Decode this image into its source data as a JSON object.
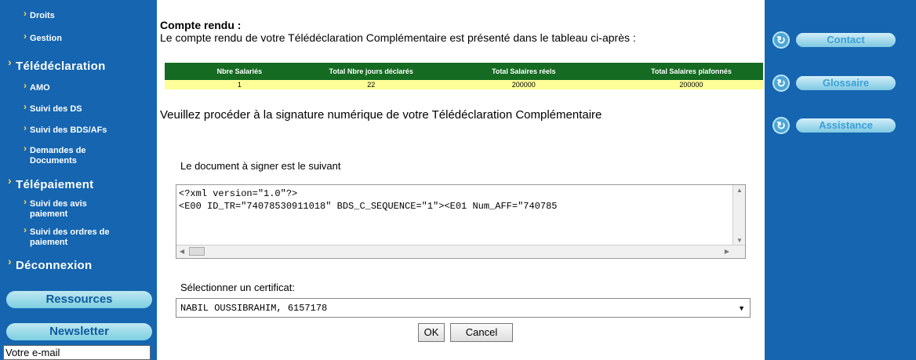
{
  "sidebar": {
    "items": [
      {
        "label": "Droits"
      },
      {
        "label": "Gestion"
      },
      {
        "label": "Télédéclaration"
      },
      {
        "label": "AMO"
      },
      {
        "label": "Suivi des DS"
      },
      {
        "label": "Suivi des BDS/AFs"
      },
      {
        "label": "Demandes de Documents"
      },
      {
        "label": "Télépaiement"
      },
      {
        "label": "Suivi des avis paiement"
      },
      {
        "label": "Suivi des ordres de paiement"
      },
      {
        "label": "Déconnexion"
      }
    ],
    "ressources": "Ressources",
    "newsletter": "Newsletter",
    "email_placeholder": "Votre e-mail"
  },
  "main": {
    "title": "Compte rendu :",
    "description": "Le compte rendu de votre Télédéclaration Complémentaire est présenté dans le tableau ci-après :",
    "table": {
      "headers": [
        "Nbre Salariés",
        "Total Nbre jours déclarés",
        "Total Salaires réels",
        "Total Salaires plafonnés"
      ],
      "row": [
        "1",
        "22",
        "200000",
        "200000"
      ]
    },
    "sign_prompt": "Veuillez procéder à la signature numérique de votre Télédéclaration Complémentaire",
    "doc_label": "Le document à signer est le suivant",
    "doc_lines": [
      "<?xml version=\"1.0\"?>",
      "<E00 ID_TR=\"74078530911018\" BDS_C_SEQUENCE=\"1\"><E01 Num_AFF=\"740785"
    ],
    "cert_label": "Sélectionner un certificat:",
    "cert_value": "NABIL OUSSIBRAHIM, 6157178",
    "ok": "OK",
    "cancel": "Cancel"
  },
  "rightbar": {
    "contact": "Contact",
    "glossaire": "Glossaire",
    "assistance": "Assistance"
  },
  "colors": {
    "sidebar_blue": "#1565b0",
    "table_header_green": "#156b22",
    "table_row_yellow": "#ffff99",
    "accent_yellow": "#ffd24a"
  }
}
